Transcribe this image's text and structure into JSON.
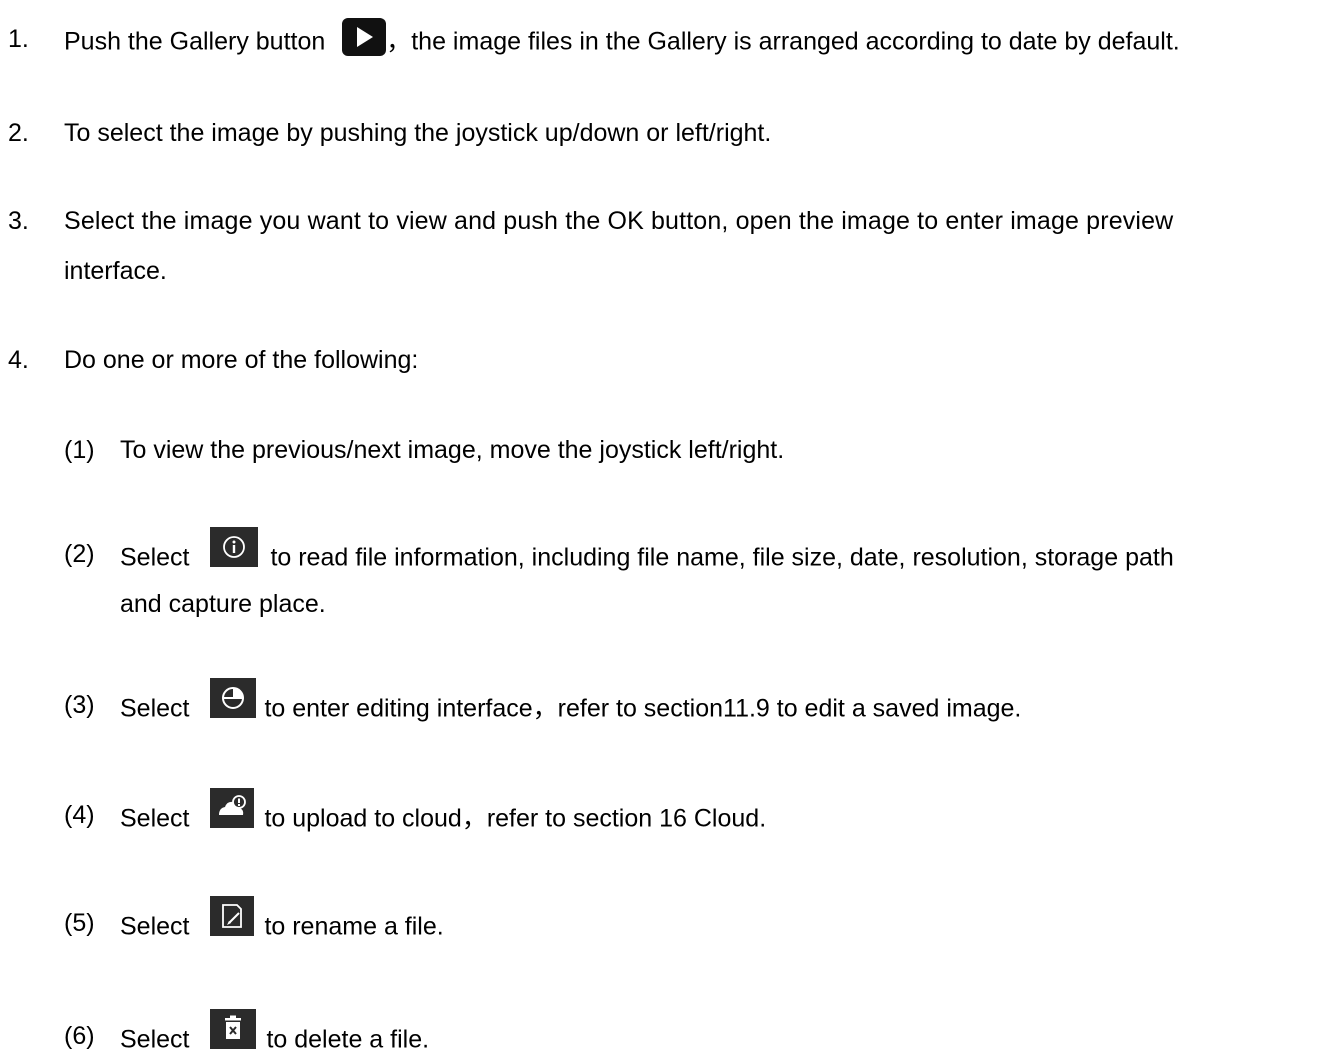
{
  "steps": [
    {
      "number": "1.",
      "text_before_icon": "Push the Gallery button",
      "icon": "play-icon",
      "text_after_icon": "，the image files in the Gallery is arranged according to date by default."
    },
    {
      "number": "2.",
      "text": "To select the image by pushing the joystick up/down or left/right."
    },
    {
      "number": "3.",
      "text_line1": "Select the image you want to view and push the OK button, open the image to enter image preview",
      "text_line2": "interface."
    },
    {
      "number": "4.",
      "text": "Do one or more of the following:"
    }
  ],
  "substeps": [
    {
      "number": "(1)",
      "text": "To view the previous/next image, move the joystick left/right."
    },
    {
      "number": "(2)",
      "text_before_icon": "Select",
      "icon": "info-icon",
      "text_after_icon": "to read file information, including file name, file size, date, resolution, storage path",
      "text_line2": "and capture place."
    },
    {
      "number": "(3)",
      "text_before_icon": "Select",
      "icon": "edit-pie-icon",
      "text_after_icon": "to enter editing interface，refer to section11.9 to edit a saved image."
    },
    {
      "number": "(4)",
      "text_before_icon": "Select",
      "icon": "cloud-upload-icon",
      "text_after_icon": "to upload to cloud，refer to section 16 Cloud."
    },
    {
      "number": "(5)",
      "text_before_icon": "Select",
      "icon": "rename-icon",
      "text_after_icon": "to rename a file."
    },
    {
      "number": "(6)",
      "text_before_icon": "Select",
      "icon": "delete-icon",
      "text_after_icon": "to delete a file."
    }
  ],
  "colors": {
    "text": "#000000",
    "icon_bg_dark": "#111111",
    "icon_bg_grey": "#2b2b2b",
    "icon_fg": "#ffffff"
  }
}
